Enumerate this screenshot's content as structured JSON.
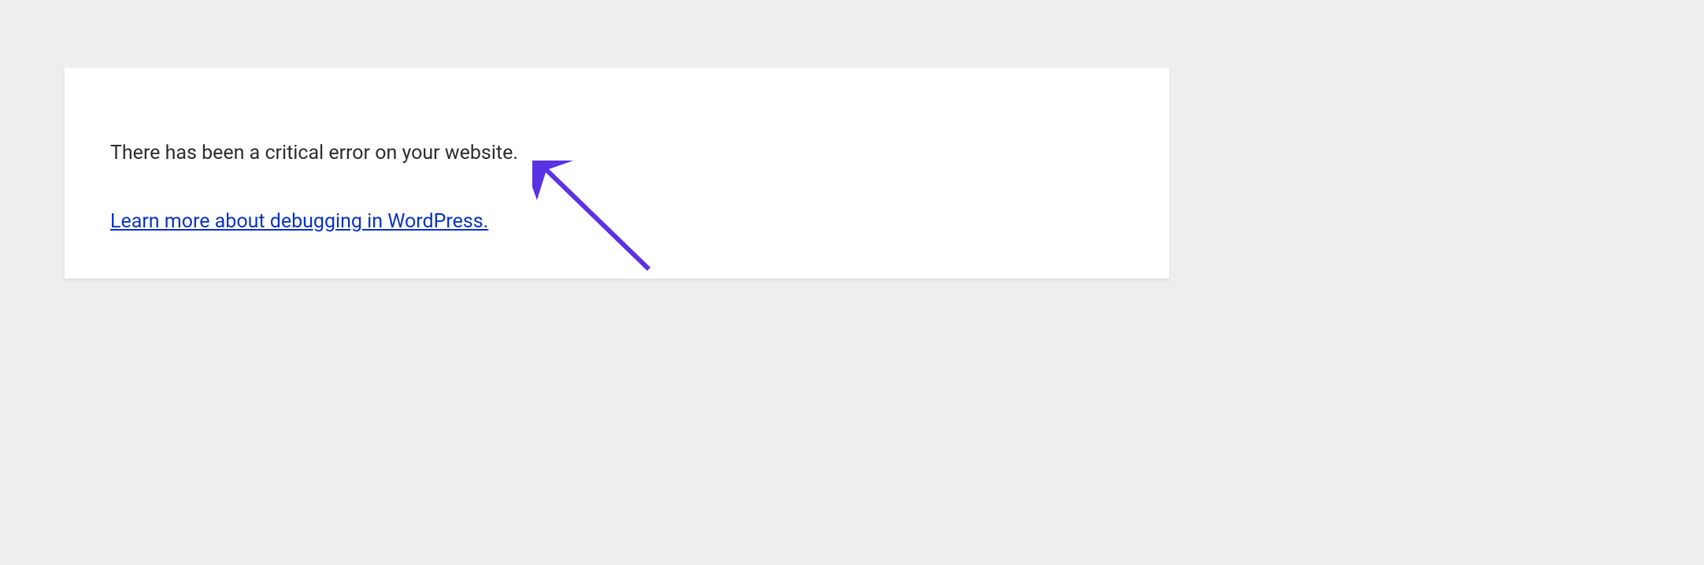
{
  "error": {
    "message": "There has been a critical error on your website.",
    "link_text": "Learn more about debugging in WordPress."
  },
  "annotation": {
    "arrow_color": "#5a32e5"
  }
}
